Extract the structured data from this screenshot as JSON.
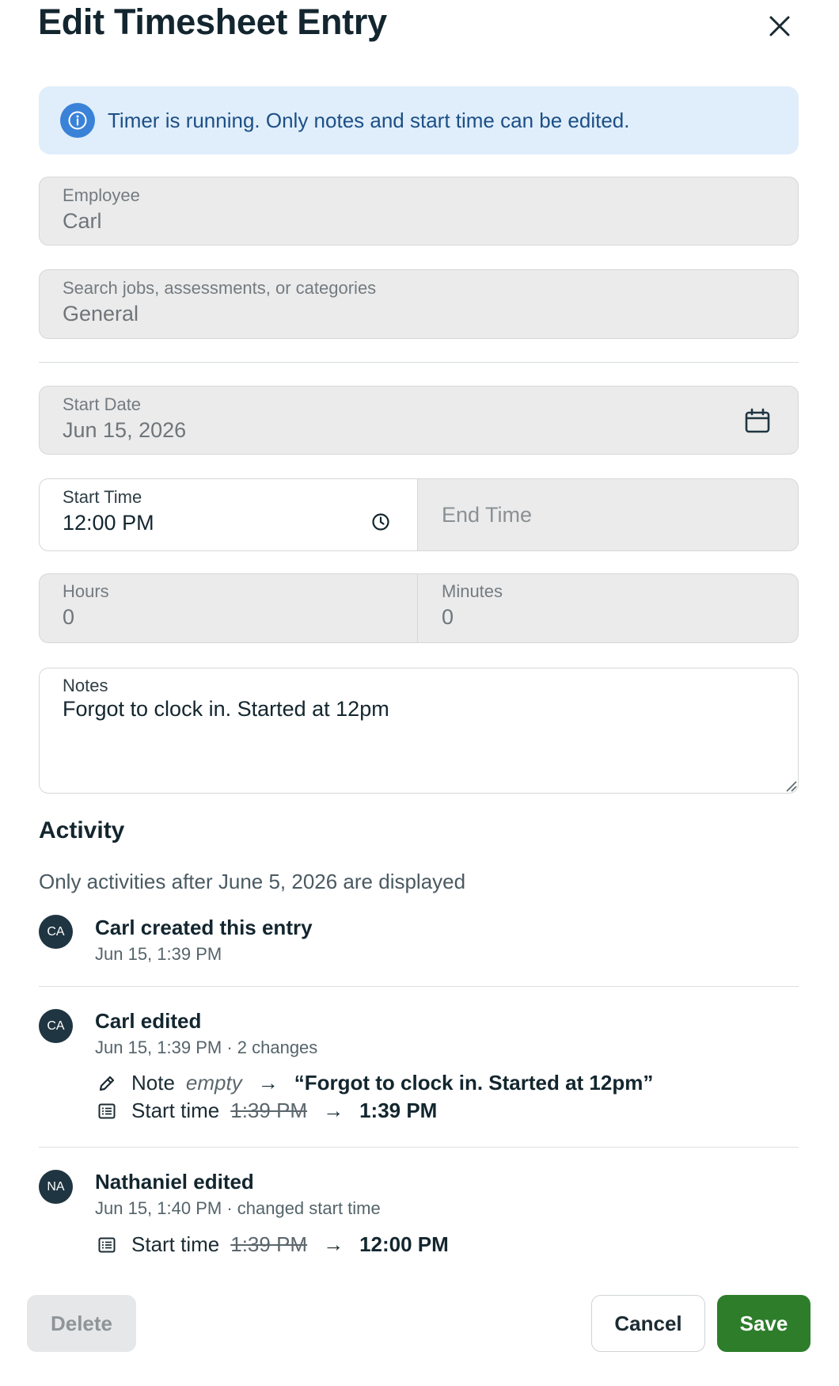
{
  "dialog": {
    "title": "Edit Timesheet Entry"
  },
  "banner": {
    "message": "Timer is running. Only notes and start time can be edited."
  },
  "employee": {
    "label": "Employee",
    "value": "Carl"
  },
  "job": {
    "label": "Search jobs, assessments, or categories",
    "value": "General"
  },
  "start_date": {
    "label": "Start Date",
    "value": "Jun 15, 2026"
  },
  "start_time": {
    "label": "Start Time",
    "value": "12:00 PM"
  },
  "end_time": {
    "placeholder": "End Time"
  },
  "hours": {
    "label": "Hours",
    "value": "0"
  },
  "minutes": {
    "label": "Minutes",
    "value": "0"
  },
  "notes": {
    "label": "Notes",
    "value": "Forgot to clock in. Started at 12pm"
  },
  "activity": {
    "title": "Activity",
    "subtitle": "Only activities after June 5, 2026 are displayed",
    "items": [
      {
        "initials": "CA",
        "title": "Carl created this entry",
        "meta": "Jun 15, 1:39 PM"
      },
      {
        "initials": "CA",
        "title": "Carl edited",
        "meta": "Jun 15, 1:39 PM · 2 changes",
        "changes": [
          {
            "icon": "pencil-icon",
            "field": "Note",
            "old": "empty",
            "arrow": "→",
            "new": "“Forgot to clock in. Started at 12pm”"
          },
          {
            "icon": "list-icon",
            "field": "Start time",
            "old": "1:39 PM",
            "arrow": "→",
            "new": "1:39 PM"
          }
        ]
      },
      {
        "initials": "NA",
        "title": "Nathaniel edited",
        "meta": "Jun 15, 1:40 PM · changed start time",
        "changes": [
          {
            "icon": "list-icon",
            "field": "Start time",
            "old": "1:39 PM",
            "arrow": "→",
            "new": "12:00 PM"
          }
        ]
      }
    ]
  },
  "footer": {
    "delete_label": "Delete",
    "cancel_label": "Cancel",
    "save_label": "Save"
  },
  "colors": {
    "accent": "#2d7d2a",
    "info": "#3a82d8",
    "banner_bg": "#e0eefb",
    "avatar": "#1f3541"
  }
}
